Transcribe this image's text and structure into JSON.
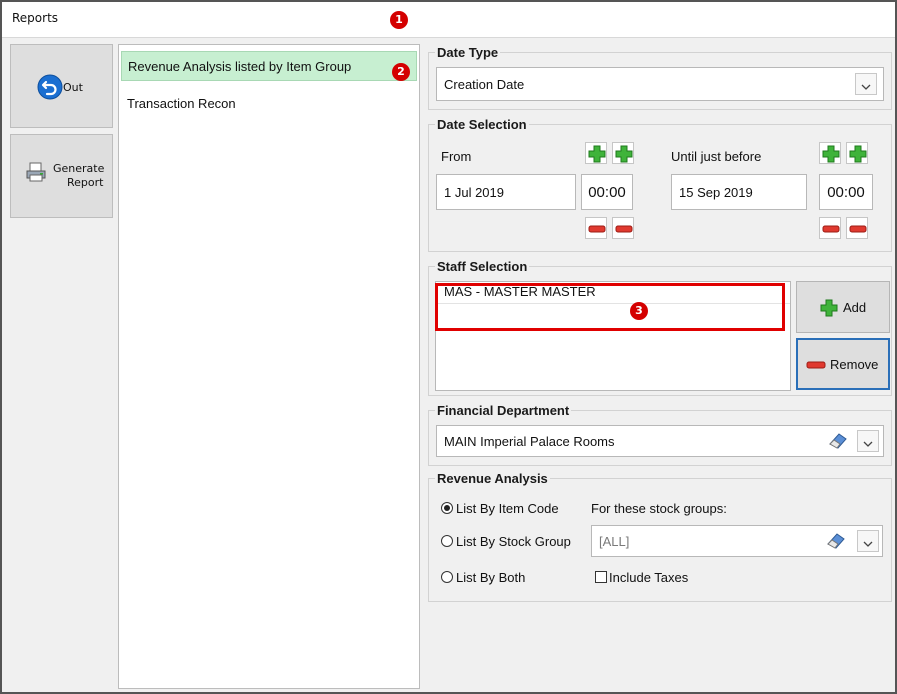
{
  "window": {
    "title": "Reports"
  },
  "markers": [
    "1",
    "2",
    "3"
  ],
  "toolbar": {
    "out_label": "Out",
    "generate_label_line1": "Generate",
    "generate_label_line2": "Report"
  },
  "reports": [
    {
      "label": "Revenue Analysis listed by Item Group",
      "selected": true
    },
    {
      "label": "Transaction Recon",
      "selected": false
    }
  ],
  "date_type": {
    "legend": "Date Type",
    "value": "Creation Date"
  },
  "date_selection": {
    "legend": "Date Selection",
    "from_label": "From",
    "from_date": "1 Jul 2019",
    "from_time": "00:00",
    "until_label": "Until just before",
    "until_date": "15 Sep 2019",
    "until_time": "00:00"
  },
  "staff_selection": {
    "legend": "Staff Selection",
    "items": [
      "MAS - MASTER MASTER"
    ],
    "add_label": "Add",
    "remove_label": "Remove"
  },
  "financial_department": {
    "legend": "Financial Department",
    "value": "MAIN Imperial Palace Rooms"
  },
  "revenue_analysis": {
    "legend": "Revenue Analysis",
    "options": [
      "List By Item Code",
      "List By Stock Group",
      "List By Both"
    ],
    "selected_index": 0,
    "stock_groups_label": "For these stock groups:",
    "stock_groups_value": "[ALL]",
    "include_taxes_label": "Include Taxes",
    "include_taxes_checked": false
  },
  "colors": {
    "selected_row": "#c7efd1",
    "marker_red": "#d40000",
    "plus_green": "#34a832",
    "minus_red": "#d9322a",
    "highlight_border": "#e00000"
  }
}
